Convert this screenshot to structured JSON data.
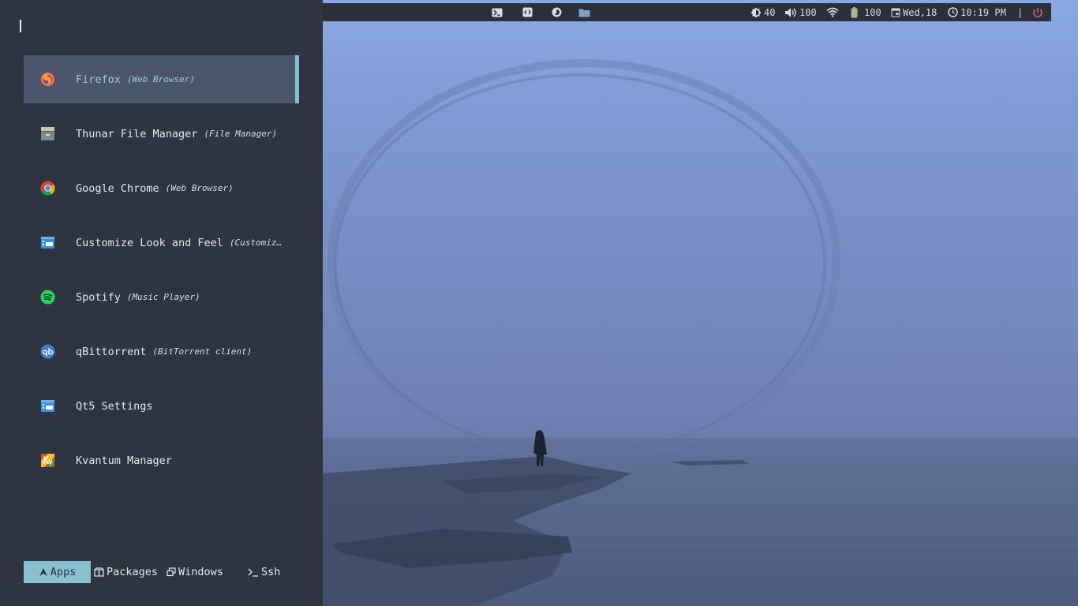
{
  "launcher": {
    "search_value": "",
    "entries": [
      {
        "name": "Firefox",
        "generic": "(Web Browser)",
        "icon": "firefox-icon"
      },
      {
        "name": "Thunar File Manager",
        "generic": "(File Manager)",
        "icon": "file-cabinet-icon"
      },
      {
        "name": "Google Chrome",
        "generic": "(Web Browser)",
        "icon": "chrome-icon"
      },
      {
        "name": "Customize Look and Feel",
        "generic": "(Customiz…",
        "icon": "settings-window-icon"
      },
      {
        "name": "Spotify",
        "generic": "(Music Player)",
        "icon": "spotify-icon"
      },
      {
        "name": "qBittorrent",
        "generic": "(BitTorrent client)",
        "icon": "qbittorrent-icon"
      },
      {
        "name": "Qt5 Settings",
        "generic": "",
        "icon": "settings-window-icon"
      },
      {
        "name": "Kvantum Manager",
        "generic": "",
        "icon": "kvantum-icon"
      }
    ],
    "modes": [
      {
        "label": "Apps",
        "icon": "arrow-up-icon",
        "active": true
      },
      {
        "label": "Packages",
        "icon": "package-icon",
        "active": false
      },
      {
        "label": "Windows",
        "icon": "windows-icon",
        "active": false
      },
      {
        "label": "Ssh",
        "icon": "terminal-prompt-icon",
        "active": false
      }
    ]
  },
  "topbar": {
    "apps": [
      "terminal-icon",
      "code-editor-icon",
      "firefox-icon",
      "folder-icon"
    ],
    "brightness": "40",
    "volume": "100",
    "battery": "100",
    "date": "Wed,18",
    "time": "10:19 PM",
    "separator": "|"
  },
  "colors": {
    "panel_bg": "#2e3440",
    "selected_bg": "#4c566a",
    "accent": "#88c0d0",
    "power": "#bf616a"
  }
}
